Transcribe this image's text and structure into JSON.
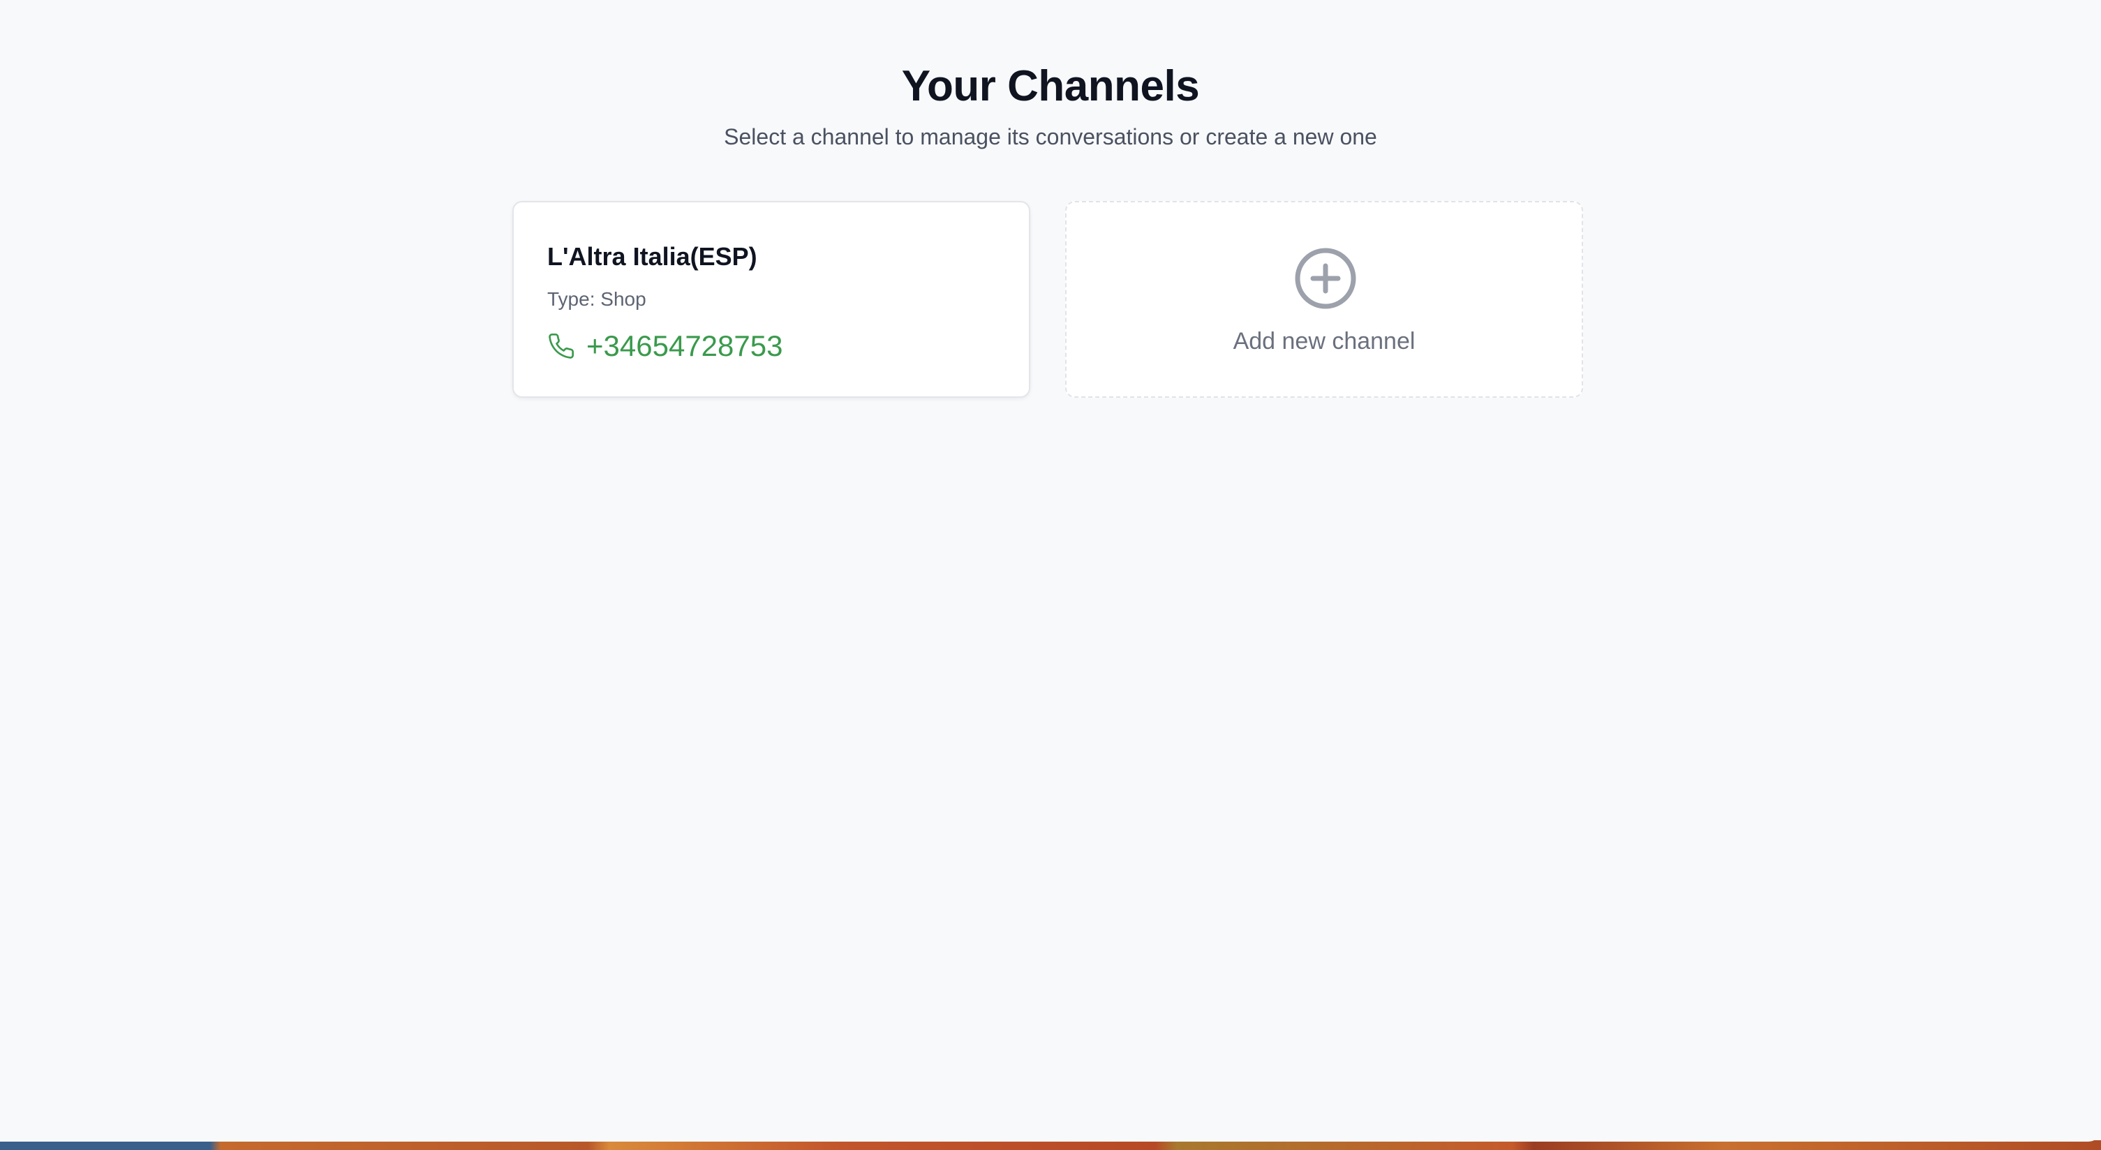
{
  "page": {
    "title": "Your Channels",
    "subtitle": "Select a channel to manage its conversations or create a new one"
  },
  "channels": [
    {
      "name": "L'Altra Italia(ESP)",
      "type": "Type: Shop",
      "phone": "+34654728753",
      "icon": "phone-icon"
    }
  ],
  "add_channel": {
    "label": "Add new channel",
    "icon": "plus-circle-icon"
  },
  "colors": {
    "background": "#f8f9fb",
    "card_background": "#ffffff",
    "phone_accent": "#3a9a4c",
    "muted_text": "#6a707d",
    "heading_text": "#0f1420"
  }
}
